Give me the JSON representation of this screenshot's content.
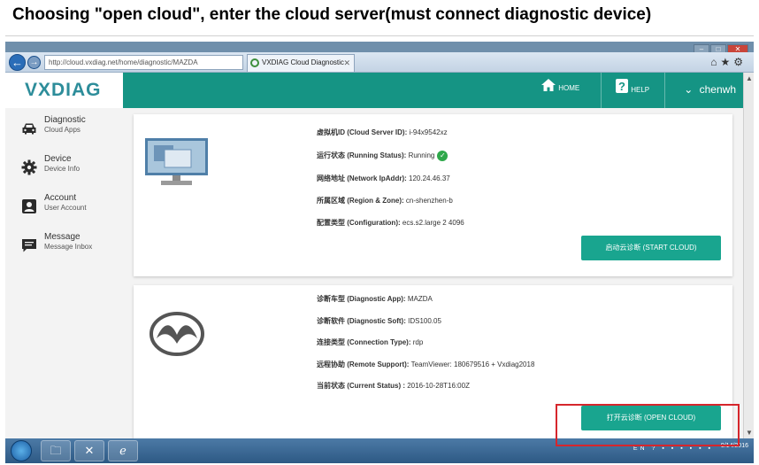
{
  "caption": "Choosing \"open cloud\", enter the cloud server(must connect diagnostic device)",
  "browser": {
    "url": "http://cloud.vxdiag.net/home/diagnostic/MAZDA",
    "tab_title": "VXDIAG Cloud Diagnostic"
  },
  "header": {
    "logo": "VXDIAG",
    "home_label": "HOME",
    "help_label": "HELP",
    "user_name": "chenwh"
  },
  "sidebar": {
    "items": [
      {
        "title": "Diagnostic",
        "subtitle": "Cloud Apps",
        "icon": "car-icon"
      },
      {
        "title": "Device",
        "subtitle": "Device Info",
        "icon": "gear-icon"
      },
      {
        "title": "Account",
        "subtitle": "User Account",
        "icon": "user-icon"
      },
      {
        "title": "Message",
        "subtitle": "Message Inbox",
        "icon": "message-icon"
      }
    ]
  },
  "server_card": {
    "rows": [
      {
        "label": "虚拟机ID (Cloud Server ID):",
        "value": "i-94x9542xz"
      },
      {
        "label": "运行状态 (Running Status):",
        "value": "Running"
      },
      {
        "label": "网络地址 (Network IpAddr):",
        "value": "120.24.46.37"
      },
      {
        "label": "所属区域 (Region & Zone):",
        "value": "cn-shenzhen-b"
      },
      {
        "label": "配置类型 (Configuration):",
        "value": "ecs.s2.large 2 4096"
      }
    ],
    "button_label": "启动云诊断 (START CLOUD)"
  },
  "diag_card": {
    "rows": [
      {
        "label": "诊断车型 (Diagnostic App):",
        "value": "MAZDA"
      },
      {
        "label": "诊断软件 (Diagnostic Soft):",
        "value": "IDS100.05"
      },
      {
        "label": "连接类型 (Connection Type):",
        "value": "rdp"
      },
      {
        "label": "远程协助 (Remote Support):",
        "value": "TeamViewer: 180679516 + Vxdiag2018"
      },
      {
        "label": "当前状态 (Current Status) :",
        "value": "2016-10-28T16:00Z"
      }
    ],
    "button_label": "打开云诊断 (OPEN CLOUD)"
  },
  "taskbar": {
    "lang": "EN",
    "date": "9/14/2016"
  },
  "colors": {
    "header": "#159484",
    "button": "#19a58f",
    "highlight": "#d6262c",
    "logo": "#2d8d9a"
  }
}
